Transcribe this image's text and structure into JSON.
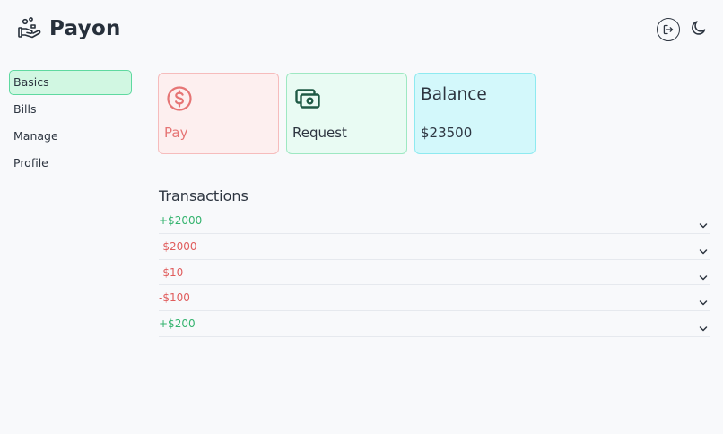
{
  "app": {
    "name": "Payon"
  },
  "header": {
    "logout_icon": "logout-icon",
    "theme_icon": "moon-icon"
  },
  "sidebar": {
    "items": [
      {
        "label": "Basics",
        "active": true
      },
      {
        "label": "Bills",
        "active": false
      },
      {
        "label": "Manage",
        "active": false
      },
      {
        "label": "Profile",
        "active": false
      }
    ]
  },
  "cards": {
    "pay": {
      "label": "Pay",
      "icon": "dollar-circle-icon",
      "color": "#e67575"
    },
    "request": {
      "label": "Request",
      "icon": "cash-icon",
      "color": "#1f5a45"
    },
    "balance": {
      "title": "Balance",
      "value": "$23500"
    }
  },
  "transactions": {
    "title": "Transactions",
    "items": [
      {
        "amount": "+$2000",
        "type": "credit"
      },
      {
        "amount": "-$2000",
        "type": "debit"
      },
      {
        "amount": "-$10",
        "type": "debit"
      },
      {
        "amount": "-$100",
        "type": "debit"
      },
      {
        "amount": "+$200",
        "type": "credit"
      }
    ]
  },
  "colors": {
    "credit": "#34b36e",
    "debit": "#e05d5d",
    "active_nav_bg": "#d1f7e2",
    "active_nav_border": "#5fd9a0"
  }
}
